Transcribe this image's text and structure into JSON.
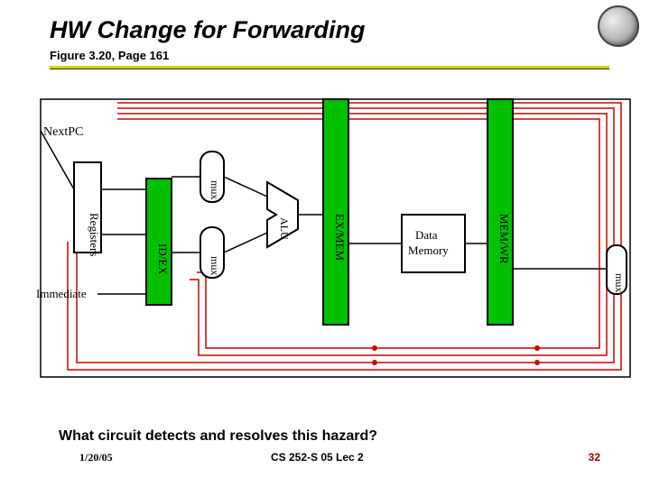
{
  "title": "HW Change for Forwarding",
  "subtitle": "Figure 3.20, Page 161",
  "labels": {
    "nextpc": "NextPC",
    "registers": "Registers",
    "idex": "ID/EX",
    "mux1": "mux",
    "mux2": "mux",
    "alu": "ALU",
    "exmem": "EX/MEM",
    "datamem": "Data\nMemory",
    "memwr": "MEM/WR",
    "mux3": "mux",
    "immediate": "Immediate"
  },
  "question": "What circuit detects and resolves this hazard?",
  "date": "1/20/05",
  "course": "CS 252-S 05 Lec 2",
  "slidenum": "32"
}
